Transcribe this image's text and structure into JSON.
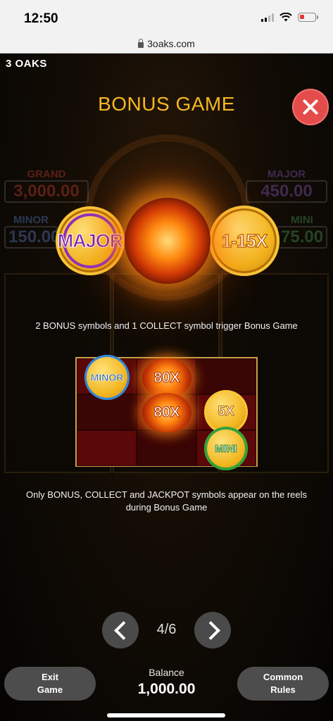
{
  "status_bar": {
    "time": "12:50"
  },
  "browser": {
    "url": "3oaks.com"
  },
  "game": {
    "brand": "3 OAKS",
    "title": "BONUS GAME",
    "background_jackpots": {
      "grand": {
        "name": "GRAND",
        "amount": "3,000.00"
      },
      "major": {
        "name": "MAJOR",
        "amount": "450.00"
      },
      "minor": {
        "name": "MINOR",
        "amount": "150.00"
      },
      "mini": {
        "name": "MINI",
        "amount": "75.00"
      }
    },
    "trigger_symbols": {
      "major_coin": "MAJOR",
      "multiplier_coin": "1-15X"
    },
    "caption_trigger": "2 BONUS symbols and 1 COLLECT symbol trigger Bonus Game",
    "reel_symbols": {
      "minor_coin": "MINOR",
      "sun_top": "80X",
      "sun_bottom": "80X",
      "gold_coin": "5X",
      "mini_coin": "MINI"
    },
    "caption_reels": "Only BONUS, COLLECT and JACKPOT symbols appear on the reels during Bonus Game",
    "pagination": {
      "current": 4,
      "total": 6,
      "label": "4/6"
    }
  },
  "footer": {
    "exit_label": "Exit Game",
    "balance_label": "Balance",
    "balance_value": "1,000.00",
    "rules_label": "Common Rules"
  },
  "colors": {
    "title": "#f5b722",
    "close": "#e44c4c",
    "button_bg": "#4d4d4d"
  },
  "icons": [
    "lock-icon",
    "close-icon",
    "chevron-left-icon",
    "chevron-right-icon",
    "wifi-icon",
    "battery-icon",
    "signal-icon"
  ]
}
